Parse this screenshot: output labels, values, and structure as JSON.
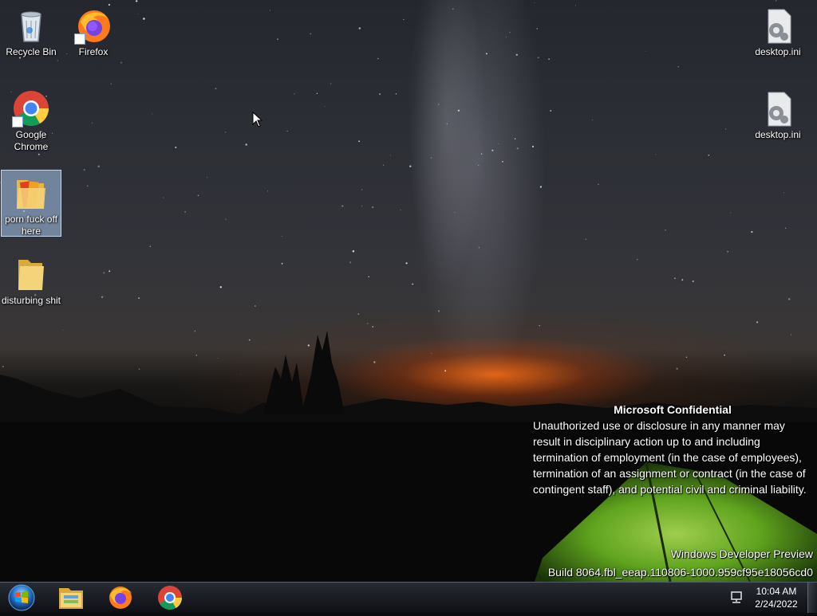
{
  "desktop": {
    "icons": [
      {
        "label": "Recycle Bin",
        "icon": "recycle-bin-icon"
      },
      {
        "label": "Firefox",
        "icon": "firefox-icon"
      },
      {
        "label": "Google Chrome",
        "icon": "chrome-icon"
      },
      {
        "label": "porn fuck off here",
        "icon": "media-folder-icon",
        "selected": true
      },
      {
        "label": "disturbing shit",
        "icon": "folder-icon"
      },
      {
        "label": "desktop.ini",
        "icon": "settings-file-icon"
      },
      {
        "label": "desktop.ini",
        "icon": "settings-file-icon"
      }
    ]
  },
  "watermark": {
    "title": "Microsoft Confidential",
    "body": "Unauthorized use or disclosure in any manner may result in disciplinary action up to and including termination of employment (in the case of employees), termination of an assignment or contract (in the case of contingent staff), and potential civil and criminal liability.",
    "product": "Windows Developer Preview",
    "build": "Build 8064.fbl_eeap.110806-1000.959cf95e18056cd0"
  },
  "taskbar": {
    "pinned": [
      {
        "name": "file-explorer",
        "icon": "file-explorer-icon"
      },
      {
        "name": "firefox",
        "icon": "firefox-icon"
      },
      {
        "name": "chrome",
        "icon": "chrome-icon"
      }
    ],
    "clock": {
      "time": "10:04 AM",
      "date": "2/24/2022"
    }
  },
  "colors": {
    "accent": "#1e7fd8",
    "folder": "#f0c85a",
    "tent_green": "#7fd52a",
    "horizon_orange": "#ff6e14"
  }
}
